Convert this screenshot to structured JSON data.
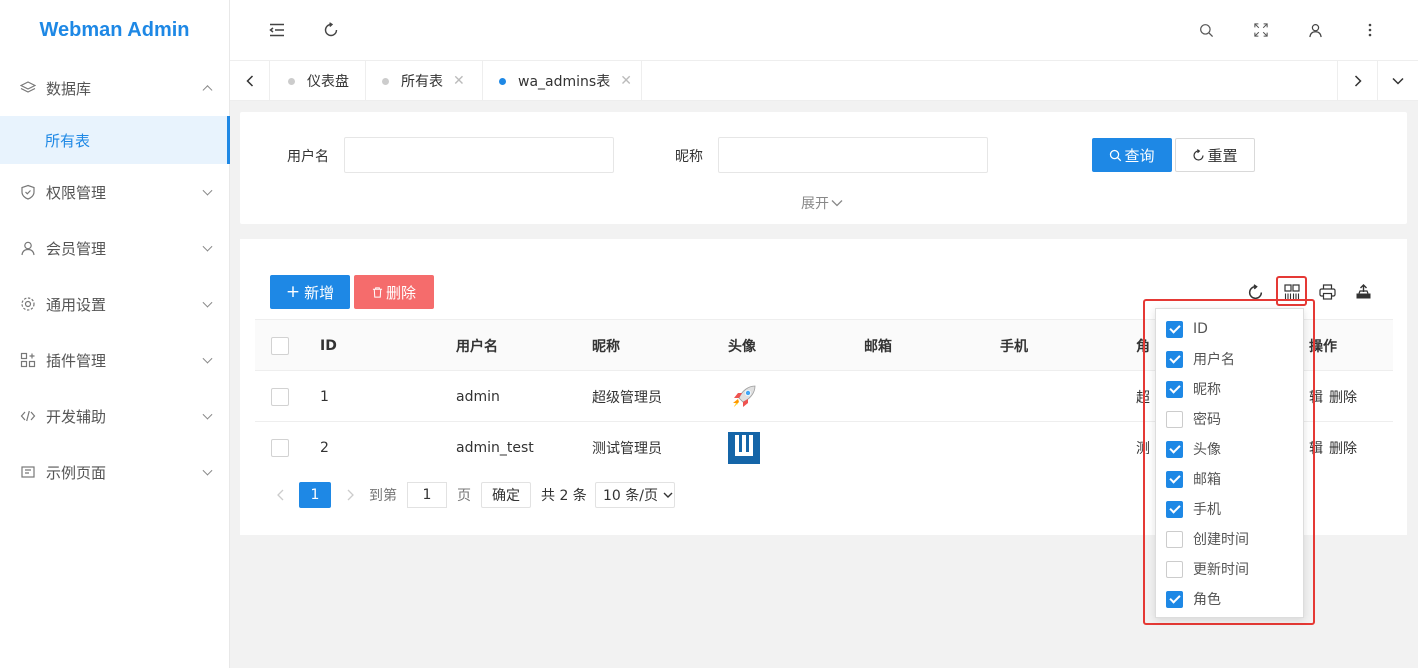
{
  "app": {
    "title": "Webman Admin"
  },
  "sidebar": {
    "items": [
      {
        "label": "数据库",
        "icon": "layers-icon",
        "expanded": true
      },
      {
        "label": "权限管理",
        "icon": "shield-icon"
      },
      {
        "label": "会员管理",
        "icon": "user-icon"
      },
      {
        "label": "通用设置",
        "icon": "gear-icon"
      },
      {
        "label": "插件管理",
        "icon": "plugin-icon"
      },
      {
        "label": "开发辅助",
        "icon": "code-icon"
      },
      {
        "label": "示例页面",
        "icon": "page-icon"
      }
    ],
    "sub_items": [
      {
        "label": "所有表",
        "active": true
      }
    ]
  },
  "tabs": [
    {
      "label": "仪表盘",
      "closable": false,
      "active": false
    },
    {
      "label": "所有表",
      "closable": true,
      "active": false
    },
    {
      "label": "wa_admins表",
      "closable": true,
      "active": true
    }
  ],
  "search": {
    "username_label": "用户名",
    "username_value": "",
    "nickname_label": "昵称",
    "nickname_value": "",
    "query_button": "查询",
    "reset_button": "重置",
    "expand_link": "展开"
  },
  "toolbar": {
    "add_button": "新增",
    "delete_button": "删除"
  },
  "table": {
    "columns": [
      "ID",
      "用户名",
      "昵称",
      "头像",
      "邮箱",
      "手机",
      "角",
      "操作"
    ],
    "rows": [
      {
        "id": "1",
        "username": "admin",
        "nickname": "超级管理员",
        "avatar": "rocket-avatar",
        "email": "",
        "mobile": "",
        "role": "超",
        "actions": [
          "辑",
          "删除"
        ]
      },
      {
        "id": "2",
        "username": "admin_test",
        "nickname": "测试管理员",
        "avatar": "logo-avatar",
        "email": "",
        "mobile": "",
        "role": "测",
        "actions": [
          "辑",
          "删除"
        ]
      }
    ]
  },
  "pagination": {
    "current_page": "1",
    "goto_prefix": "到第",
    "goto_value": "1",
    "goto_suffix": "页",
    "confirm": "确定",
    "total": "共 2 条",
    "page_size": "10 条/页"
  },
  "column_filter": {
    "items": [
      {
        "label": "ID",
        "checked": true
      },
      {
        "label": "用户名",
        "checked": true
      },
      {
        "label": "昵称",
        "checked": true
      },
      {
        "label": "密码",
        "checked": false
      },
      {
        "label": "头像",
        "checked": true
      },
      {
        "label": "邮箱",
        "checked": true
      },
      {
        "label": "手机",
        "checked": true
      },
      {
        "label": "创建时间",
        "checked": false
      },
      {
        "label": "更新时间",
        "checked": false
      },
      {
        "label": "角色",
        "checked": true
      }
    ]
  },
  "colors": {
    "primary": "#1e88e5",
    "danger": "#f56c6c",
    "highlight": "#e53935"
  }
}
